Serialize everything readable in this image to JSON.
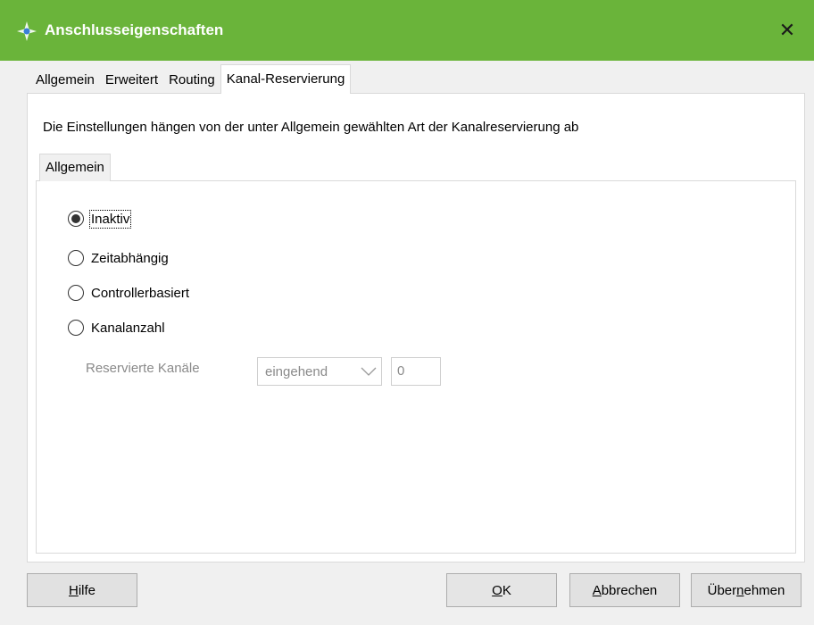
{
  "window": {
    "title": "Anschlusseigenschaften",
    "close": "✕"
  },
  "tabs": [
    {
      "label": "Allgemein"
    },
    {
      "label": "Erweitert"
    },
    {
      "label": "Routing"
    },
    {
      "label": "Kanal-Reservierung"
    }
  ],
  "active_tab": "Kanal-Reservierung",
  "description": "Die Einstellungen hängen von der unter Allgemein gewählten Art der Kanalreservierung ab",
  "subtab": {
    "label": "Allgemein"
  },
  "options": [
    {
      "label": "Inaktiv",
      "selected": true
    },
    {
      "label": "Zeitabhängig",
      "selected": false
    },
    {
      "label": "Controllerbasiert",
      "selected": false
    },
    {
      "label": "Kanalanzahl",
      "selected": false
    }
  ],
  "reserved": {
    "label": "Reservierte Kanäle",
    "direction": "eingehend",
    "count": "0"
  },
  "buttons": {
    "help_mnemonic": "H",
    "help_rest": "ilfe",
    "ok_mnemonic": "O",
    "ok_rest": "K",
    "cancel_pre": "",
    "cancel_mnemonic": "A",
    "cancel_rest": "bbrechen",
    "apply_pre": "Über",
    "apply_mnemonic": "n",
    "apply_rest": "ehmen"
  },
  "colors": {
    "titlebar": "#6ab43a",
    "disabled_text": "#8a8a8a"
  }
}
